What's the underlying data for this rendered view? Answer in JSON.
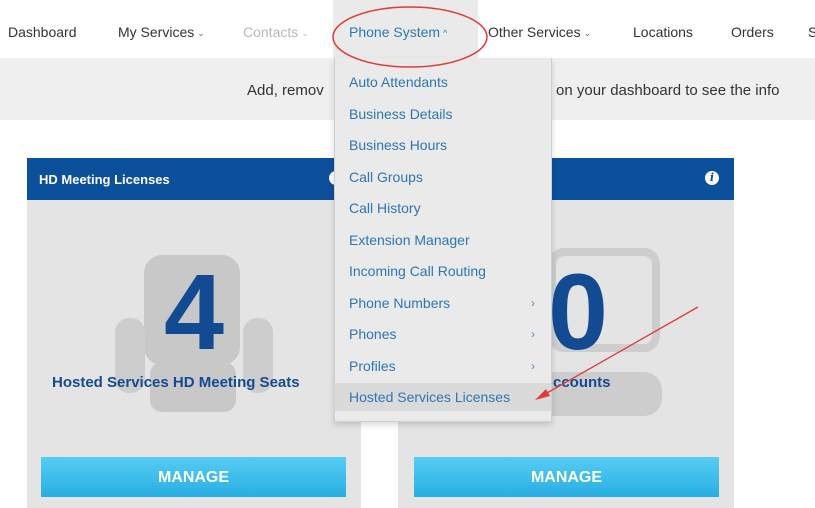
{
  "nav": {
    "items": [
      {
        "label": "Dashboard"
      },
      {
        "label": "My Services",
        "caret": "⌄"
      },
      {
        "label": "Contacts",
        "caret": "⌄"
      },
      {
        "label": "Phone System",
        "caret": "^"
      },
      {
        "label": "Other Services",
        "caret": "⌄"
      },
      {
        "label": "Locations"
      },
      {
        "label": "Orders"
      },
      {
        "label": "S"
      }
    ]
  },
  "banner": {
    "left_text": "Add, remov",
    "right_text": "on your dashboard to see the info"
  },
  "cards": [
    {
      "title": "HD Meeting Licenses",
      "count": "4",
      "label": "Hosted Services HD Meeting Seats",
      "button": "MANAGE"
    },
    {
      "title": "",
      "count": "0",
      "label": "ccounts",
      "button": "MANAGE"
    }
  ],
  "dropdown": {
    "items": [
      {
        "label": "Auto Attendants"
      },
      {
        "label": "Business Details"
      },
      {
        "label": "Business Hours"
      },
      {
        "label": "Call Groups"
      },
      {
        "label": "Call History"
      },
      {
        "label": "Extension Manager"
      },
      {
        "label": "Incoming Call Routing"
      },
      {
        "label": "Phone Numbers",
        "arrow": "›"
      },
      {
        "label": "Phones",
        "arrow": "›"
      },
      {
        "label": "Profiles",
        "arrow": "›"
      },
      {
        "label": "Hosted Services Licenses"
      }
    ]
  },
  "colors": {
    "header_blue": "#0c4f9a",
    "link_blue": "#2c76b8",
    "manage_button": "#3fbeeb",
    "annotation_red": "#e53935"
  },
  "icons": [
    "info-icon",
    "chair-icon",
    "phone-icon",
    "chevron-right-icon",
    "caret-down-icon",
    "caret-up-icon"
  ]
}
